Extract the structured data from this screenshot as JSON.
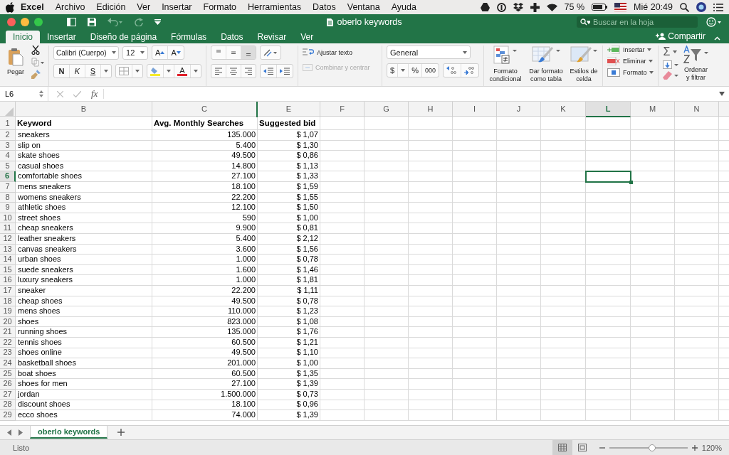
{
  "menu_bar": {
    "app": "Excel",
    "items": [
      "Archivo",
      "Edición",
      "Ver",
      "Insertar",
      "Formato",
      "Herramientas",
      "Datos",
      "Ventana",
      "Ayuda"
    ],
    "battery": "75 %",
    "clock": "Mié 20:49"
  },
  "title_bar": {
    "title": "oberlo keywords",
    "search": {
      "placeholder": "Buscar en la hoja"
    }
  },
  "ribbon_tabs": [
    {
      "label": "Inicio",
      "selected": true
    },
    {
      "label": "Insertar",
      "selected": false
    },
    {
      "label": "Diseño de página",
      "selected": false
    },
    {
      "label": "Fórmulas",
      "selected": false
    },
    {
      "label": "Datos",
      "selected": false
    },
    {
      "label": "Revisar",
      "selected": false
    },
    {
      "label": "Ver",
      "selected": false
    }
  ],
  "share": "Compartir",
  "ribbon": {
    "paste": "Pegar",
    "font": "Calibri (Cuerpo)",
    "size": "12",
    "grow": "A",
    "shrink": "A",
    "bold": "N",
    "italic": "K",
    "underline": "S",
    "font_color": "A",
    "wrap": {
      "label": "Ajustar texto",
      "disabled": false
    },
    "merge": {
      "label": "Combinar y centrar",
      "disabled": true
    },
    "number_format": "General",
    "currency": "$",
    "percent": "%",
    "thousands": "000",
    "conditional": "Formato condicional",
    "as_table": "Dar formato como tabla",
    "cell_styles": "Estilos de celda",
    "insert": "Insertar",
    "delete": "Eliminar",
    "format": "Formato",
    "sigma": "Σ",
    "sort": "Ordenar y filtrar"
  },
  "formula_bar": {
    "name_box": "L6",
    "fx": "fx"
  },
  "sheet": {
    "columns": [
      {
        "label": "B",
        "selected": false
      },
      {
        "label": "C",
        "selected": false
      },
      {
        "label": "E",
        "selected": false
      },
      {
        "label": "F",
        "selected": false
      },
      {
        "label": "G",
        "selected": false
      },
      {
        "label": "H",
        "selected": false
      },
      {
        "label": "I",
        "selected": false
      },
      {
        "label": "J",
        "selected": false
      },
      {
        "label": "K",
        "selected": false
      },
      {
        "label": "L",
        "selected": true
      },
      {
        "label": "M",
        "selected": false
      },
      {
        "label": "N",
        "selected": false
      }
    ],
    "rows": [
      {
        "number": "1",
        "kind": "header",
        "selected": false,
        "cells": [
          "Keyword",
          "Avg. Monthly Searches",
          "Suggested bid"
        ]
      },
      {
        "number": "2",
        "kind": "data",
        "selected": false,
        "cells": [
          "sneakers",
          "135.000",
          "$ 1,07"
        ]
      },
      {
        "number": "3",
        "kind": "data",
        "selected": false,
        "cells": [
          "slip on",
          "5.400",
          "$ 1,30"
        ]
      },
      {
        "number": "4",
        "kind": "data",
        "selected": false,
        "cells": [
          "skate shoes",
          "49.500",
          "$ 0,86"
        ]
      },
      {
        "number": "5",
        "kind": "data",
        "selected": false,
        "cells": [
          "casual shoes",
          "14.800",
          "$ 1,13"
        ]
      },
      {
        "number": "6",
        "kind": "data",
        "selected": true,
        "cells": [
          "comfortable shoes",
          "27.100",
          "$ 1,33"
        ]
      },
      {
        "number": "7",
        "kind": "data",
        "selected": false,
        "cells": [
          "mens sneakers",
          "18.100",
          "$ 1,59"
        ]
      },
      {
        "number": "8",
        "kind": "data",
        "selected": false,
        "cells": [
          "womens sneakers",
          "22.200",
          "$ 1,55"
        ]
      },
      {
        "number": "9",
        "kind": "data",
        "selected": false,
        "cells": [
          "athletic shoes",
          "12.100",
          "$ 1,50"
        ]
      },
      {
        "number": "10",
        "kind": "data",
        "selected": false,
        "cells": [
          "street shoes",
          "590",
          "$ 1,00"
        ]
      },
      {
        "number": "11",
        "kind": "data",
        "selected": false,
        "cells": [
          "cheap sneakers",
          "9.900",
          "$ 0,81"
        ]
      },
      {
        "number": "12",
        "kind": "data",
        "selected": false,
        "cells": [
          "leather sneakers",
          "5.400",
          "$ 2,12"
        ]
      },
      {
        "number": "13",
        "kind": "data",
        "selected": false,
        "cells": [
          "canvas sneakers",
          "3.600",
          "$ 1,56"
        ]
      },
      {
        "number": "14",
        "kind": "data",
        "selected": false,
        "cells": [
          "urban shoes",
          "1.000",
          "$ 0,78"
        ]
      },
      {
        "number": "15",
        "kind": "data",
        "selected": false,
        "cells": [
          "suede sneakers",
          "1.600",
          "$ 1,46"
        ]
      },
      {
        "number": "16",
        "kind": "data",
        "selected": false,
        "cells": [
          "luxury sneakers",
          "1.000",
          "$ 1,81"
        ]
      },
      {
        "number": "17",
        "kind": "data",
        "selected": false,
        "cells": [
          "sneaker",
          "22.200",
          "$ 1,11"
        ]
      },
      {
        "number": "18",
        "kind": "data",
        "selected": false,
        "cells": [
          "cheap shoes",
          "49.500",
          "$ 0,78"
        ]
      },
      {
        "number": "19",
        "kind": "data",
        "selected": false,
        "cells": [
          "mens shoes",
          "110.000",
          "$ 1,23"
        ]
      },
      {
        "number": "20",
        "kind": "data",
        "selected": false,
        "cells": [
          "shoes",
          "823.000",
          "$ 1,08"
        ]
      },
      {
        "number": "21",
        "kind": "data",
        "selected": false,
        "cells": [
          "running shoes",
          "135.000",
          "$ 1,76"
        ]
      },
      {
        "number": "22",
        "kind": "data",
        "selected": false,
        "cells": [
          "tennis shoes",
          "60.500",
          "$ 1,21"
        ]
      },
      {
        "number": "23",
        "kind": "data",
        "selected": false,
        "cells": [
          "shoes online",
          "49.500",
          "$ 1,10"
        ]
      },
      {
        "number": "24",
        "kind": "data",
        "selected": false,
        "cells": [
          "basketball shoes",
          "201.000",
          "$ 1,00"
        ]
      },
      {
        "number": "25",
        "kind": "data",
        "selected": false,
        "cells": [
          "boat shoes",
          "60.500",
          "$ 1,35"
        ]
      },
      {
        "number": "26",
        "kind": "data",
        "selected": false,
        "cells": [
          "shoes for men",
          "27.100",
          "$ 1,39"
        ]
      },
      {
        "number": "27",
        "kind": "data",
        "selected": false,
        "cells": [
          "jordan",
          "1.500.000",
          "$ 0,73"
        ]
      },
      {
        "number": "28",
        "kind": "data",
        "selected": false,
        "cells": [
          "discount shoes",
          "18.100",
          "$ 0,96"
        ]
      },
      {
        "number": "29",
        "kind": "data",
        "selected": false,
        "cells": [
          "ecco shoes",
          "74.000",
          "$ 1,39"
        ]
      }
    ]
  },
  "sheet_tabs": [
    {
      "label": "oberlo keywords",
      "selected": true
    }
  ],
  "status_bar": {
    "status": "Listo",
    "zoom_slider": {
      "level": 0.55
    },
    "zoom": "120%"
  }
}
